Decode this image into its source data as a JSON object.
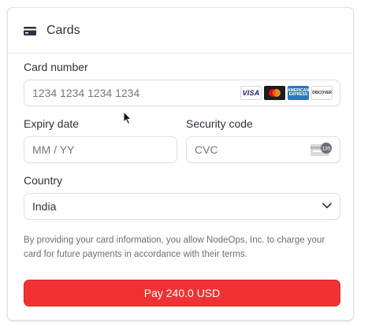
{
  "header": {
    "title": "Cards",
    "icon": "credit-card-icon"
  },
  "card_number": {
    "label": "Card number",
    "placeholder": "1234 1234 1234 1234",
    "brands": [
      {
        "name": "visa",
        "text": "VISA"
      },
      {
        "name": "mastercard",
        "text": ""
      },
      {
        "name": "amex",
        "text": "AMERICAN EXPRESS"
      },
      {
        "name": "discover",
        "text": "DISCOVER"
      }
    ]
  },
  "expiry": {
    "label": "Expiry date",
    "placeholder": "MM / YY"
  },
  "security": {
    "label": "Security code",
    "placeholder": "CVC",
    "icon": "cvc-card-icon",
    "icon_text": "135"
  },
  "country": {
    "label": "Country",
    "value": "India",
    "icon": "chevron-down-icon"
  },
  "disclaimer": "By providing your card information, you allow NodeOps, Inc. to charge your card for future payments in accordance with their terms.",
  "pay_button": {
    "label": "Pay 240.0 USD",
    "color": "#f03232"
  }
}
